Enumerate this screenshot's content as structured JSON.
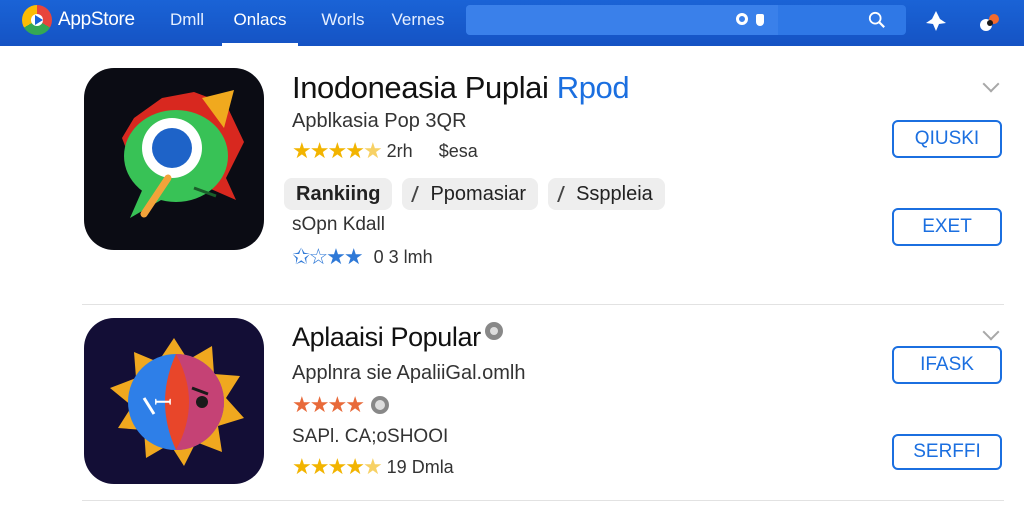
{
  "header": {
    "brand": "AppStore",
    "tabs": [
      {
        "label": "Dmll"
      },
      {
        "label": "Onlacs"
      },
      {
        "label": "Worls"
      },
      {
        "label": "Vernes"
      }
    ],
    "search": {
      "placeholder": "",
      "value": ""
    }
  },
  "apps": [
    {
      "title": "Inodoneasia Puplai",
      "title_accent": "Rpod",
      "subtitle": "Apblkasia Pop 3QR",
      "rating_stars": 4.5,
      "rating_meta": "2rh",
      "price_meta": "$esa",
      "chips": [
        "Rankiing",
        "Ppomasiar",
        "Ssppleia"
      ],
      "info_line": "sOpn Kdall",
      "secondary_rating_meta": "0 3 lmh",
      "buttons": [
        "QIUSKI",
        "EXET"
      ]
    },
    {
      "title": "Aplaaisi Popular",
      "subtitle": "Applnra  sie ApaliiGal.omlh",
      "rating_stars": 4,
      "info_line": "SAPl. CA;oSHOOI",
      "secondary_rating_meta": "19 Dmla",
      "buttons": [
        "IFASK",
        "SERFFI"
      ]
    }
  ],
  "colors": {
    "accent": "#1b6fe0",
    "topbar": "#1553c4",
    "star_gold": "#f2b400",
    "star_orange": "#e86a3a"
  }
}
